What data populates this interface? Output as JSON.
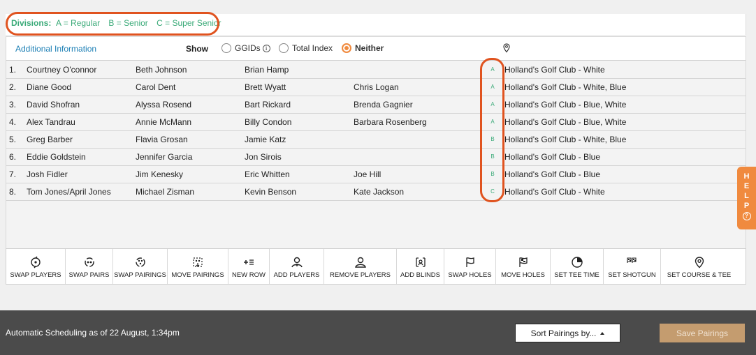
{
  "divisions": {
    "label": "Divisions:",
    "items": [
      "A = Regular",
      "B = Senior",
      "C = Super Senior"
    ]
  },
  "info_row": {
    "additional_info": "Additional Information",
    "show_label": "Show",
    "options": [
      "GGIDs",
      "Total Index",
      "Neither"
    ],
    "selected": "Neither"
  },
  "pairings": [
    {
      "num": "1.",
      "players": [
        "Courtney O'connor",
        "Beth Johnson",
        "Brian Hamp",
        ""
      ],
      "division": "A",
      "course": "Holland's Golf Club - White"
    },
    {
      "num": "2.",
      "players": [
        "Diane Good",
        "Carol Dent",
        "Brett Wyatt",
        "Chris Logan"
      ],
      "division": "A",
      "course": "Holland's Golf Club - White, Blue"
    },
    {
      "num": "3.",
      "players": [
        "David Shofran",
        "Alyssa Rosend",
        "Bart Rickard",
        "Brenda Gagnier"
      ],
      "division": "A",
      "course": "Holland's Golf Club - Blue, White"
    },
    {
      "num": "4.",
      "players": [
        "Alex Tandrau",
        "Annie McMann",
        "Billy Condon",
        "Barbara Rosenberg"
      ],
      "division": "A",
      "course": "Holland's Golf Club - Blue, White"
    },
    {
      "num": "5.",
      "players": [
        "Greg Barber",
        "Flavia Grosan",
        "Jamie Katz",
        ""
      ],
      "division": "B",
      "course": "Holland's Golf Club - White, Blue"
    },
    {
      "num": "6.",
      "players": [
        "Eddie Goldstein",
        "Jennifer Garcia",
        "Jon Sirois",
        ""
      ],
      "division": "B",
      "course": "Holland's Golf Club - Blue"
    },
    {
      "num": "7.",
      "players": [
        "Josh Fidler",
        "Jim Kenesky",
        "Eric Whitten",
        "Joe Hill"
      ],
      "division": "B",
      "course": "Holland's Golf Club - Blue"
    },
    {
      "num": "8.",
      "players": [
        "Tom Jones/April Jones",
        "Michael Zisman",
        "Kevin Benson",
        "Kate Jackson"
      ],
      "division": "C",
      "course": "Holland's Golf Club - White"
    }
  ],
  "toolbar": [
    {
      "label": "SWAP PLAYERS",
      "icon": "swap-players-icon"
    },
    {
      "label": "SWAP PAIRS",
      "icon": "swap-pairs-icon"
    },
    {
      "label": "SWAP PAIRINGS",
      "icon": "swap-pairings-icon"
    },
    {
      "label": "MOVE PAIRINGS",
      "icon": "move-pairings-icon"
    },
    {
      "label": "NEW ROW",
      "icon": "new-row-icon"
    },
    {
      "label": "ADD PLAYERS",
      "icon": "add-players-icon"
    },
    {
      "label": "REMOVE PLAYERS",
      "icon": "remove-players-icon"
    },
    {
      "label": "ADD BLINDS",
      "icon": "add-blinds-icon"
    },
    {
      "label": "SWAP HOLES",
      "icon": "swap-holes-icon"
    },
    {
      "label": "MOVE HOLES",
      "icon": "move-holes-icon"
    },
    {
      "label": "SET TEE TIME",
      "icon": "tee-time-icon"
    },
    {
      "label": "SET SHOTGUN",
      "icon": "shotgun-icon"
    },
    {
      "label": "SET COURSE & TEE",
      "icon": "location-pin-icon"
    }
  ],
  "footer": {
    "status": "Automatic Scheduling as of 22 August, 1:34pm",
    "sort_label": "Sort Pairings by...",
    "save_label": "Save Pairings"
  },
  "help": {
    "letters": [
      "H",
      "E",
      "L",
      "P"
    ],
    "q": "?"
  },
  "colors": {
    "accent_orange": "#f08a3e",
    "highlight_red": "#e0531f",
    "division_green": "#3aaa78",
    "link_blue": "#1c7fb5",
    "footer_bg": "#4b4b4b",
    "save_bg": "#c49c6f"
  }
}
